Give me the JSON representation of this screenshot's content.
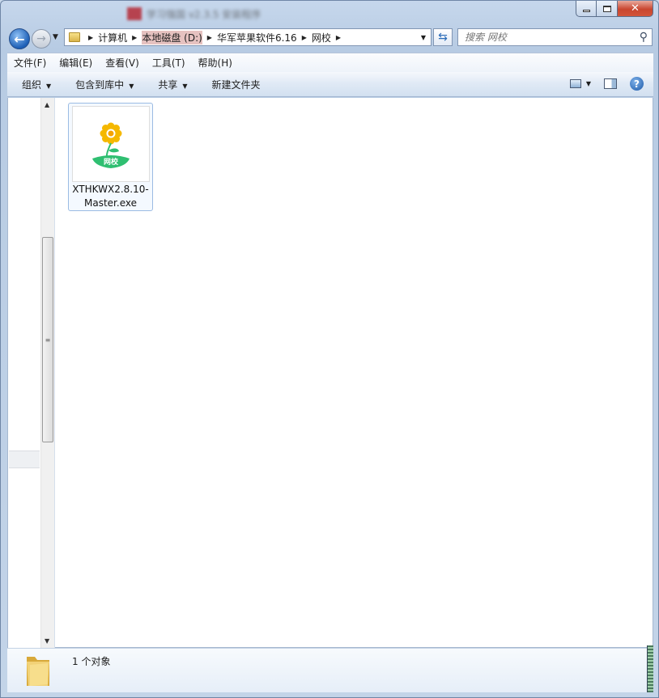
{
  "window": {
    "title": "学习强国 v2.3.5 安装程序",
    "caption": {
      "minimize_icon": "minimize-icon",
      "maximize_icon": "maximize-icon",
      "close_icon": "close-icon"
    }
  },
  "address_bar": {
    "breadcrumbs": [
      "计算机",
      "本地磁盘 (D:)",
      "华军苹果软件6.16",
      "网校"
    ],
    "search_placeholder": "搜索 网校"
  },
  "menu": [
    "文件(F)",
    "编辑(E)",
    "查看(V)",
    "工具(T)",
    "帮助(H)"
  ],
  "toolbar": {
    "organize": "组织",
    "include_in_library": "包含到库中",
    "share": "共享",
    "new_folder": "新建文件夹"
  },
  "files": [
    {
      "name": "XTHKWX2.8.10-Master.exe",
      "icon_text": "网校",
      "icon": "sunflower-app-icon"
    }
  ],
  "status": {
    "item_count": "1 个对象"
  },
  "colors": {
    "accent": "#2a6bb8",
    "selection_border": "#9bbbe3",
    "selection_fill": "#f4f9ff",
    "close_red": "#c9462f",
    "sunflower_petal": "#f5b800",
    "leaf_green": "#2fbf71"
  }
}
